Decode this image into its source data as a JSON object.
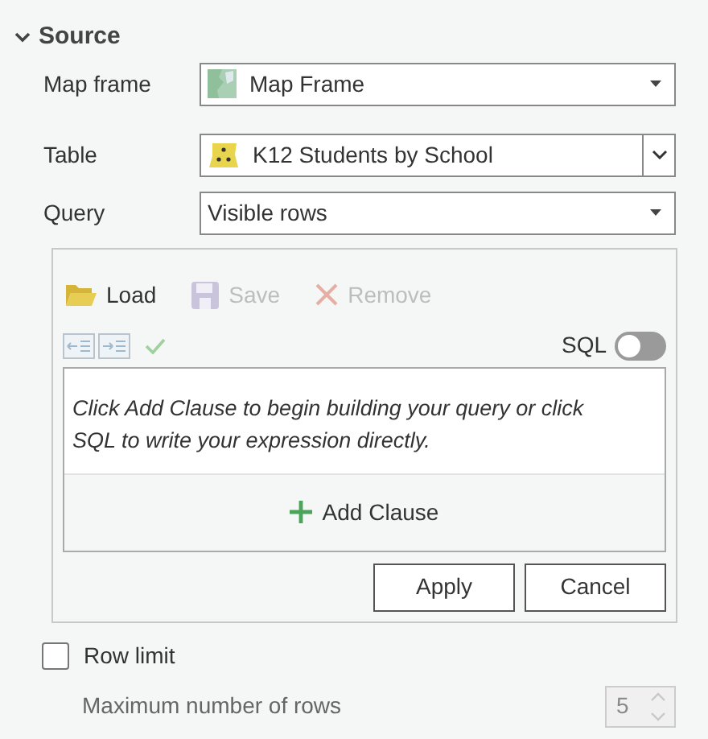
{
  "section": {
    "title": "Source",
    "expanded": true
  },
  "fields": [
    {
      "label": "Map frame",
      "value": "Map Frame",
      "kind": "map",
      "split_button": false
    },
    {
      "label": "Table",
      "value": "K12 Students by School",
      "kind": "table",
      "split_button": true
    },
    {
      "label": "Query",
      "value": "Visible rows",
      "kind": "plain",
      "split_button": false
    }
  ],
  "toolbar": [
    {
      "label": "Load",
      "kind": "load",
      "disabled": false
    },
    {
      "label": "Save",
      "kind": "save",
      "disabled": true
    },
    {
      "label": "Remove",
      "kind": "remove",
      "disabled": true
    }
  ],
  "sql_toggle": {
    "label": "SQL",
    "on": false
  },
  "hint": "Click Add Clause to begin building your query or click SQL to write your expression directly.",
  "add_clause": "Add Clause",
  "buttons": [
    "Apply",
    "Cancel"
  ],
  "row_limit": {
    "label": "Row limit",
    "checked": false
  },
  "max_rows": {
    "label": "Maximum number of rows",
    "value": "5",
    "disabled": true
  }
}
